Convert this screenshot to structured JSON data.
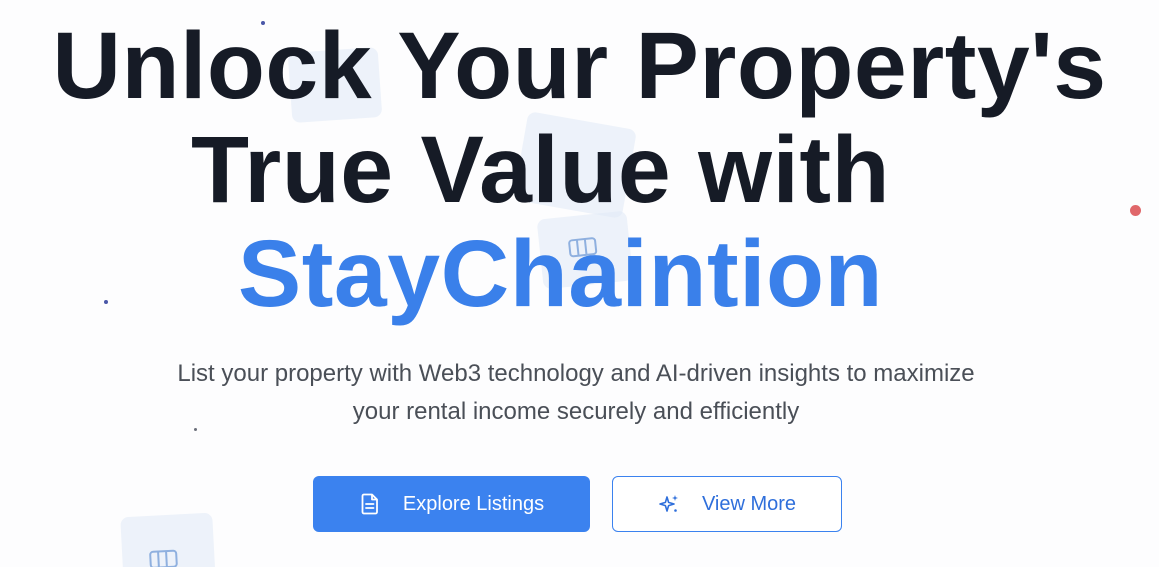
{
  "hero": {
    "title_line1": "Unlock Your Property's",
    "title_line2": "True Value with",
    "title_brand": "StayChaintion",
    "subtitle_line1": "List your property with Web3 technology and AI-driven insights to maximize",
    "subtitle_line2": "your rental income securely and efficiently"
  },
  "buttons": {
    "explore_label": "Explore Listings",
    "explore_icon": "document-icon",
    "view_more_label": "View More",
    "view_more_icon": "sparkles-icon"
  },
  "colors": {
    "title": "#161b26",
    "brand": "#3a80ea",
    "primary_button": "#3b82ef",
    "subtitle": "#4a4f57"
  }
}
